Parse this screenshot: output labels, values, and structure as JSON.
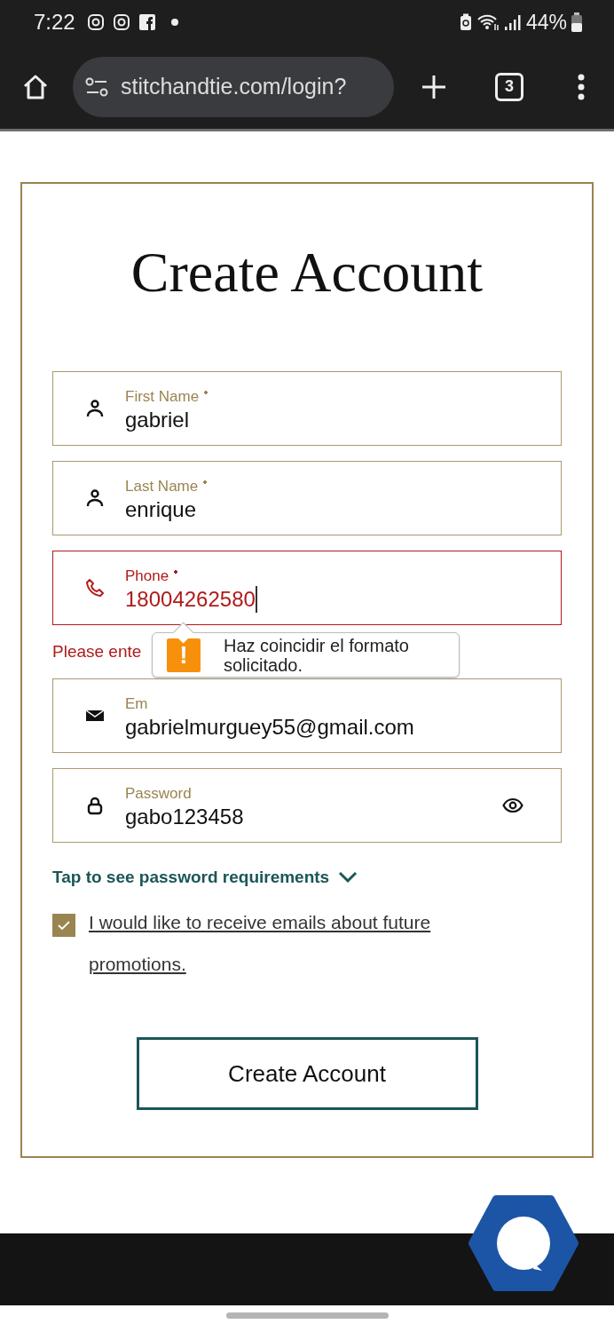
{
  "status_bar": {
    "time": "7:22",
    "battery": "44%"
  },
  "browser": {
    "url": "stitchandtie.com/login?",
    "tab_count": "3"
  },
  "form": {
    "title": "Create Account",
    "fields": [
      {
        "kind": "name",
        "label": "First Name",
        "required": true,
        "value": "gabriel",
        "invalid": false
      },
      {
        "kind": "name",
        "label": "Last Name",
        "required": true,
        "value": "enrique",
        "invalid": false
      },
      {
        "kind": "phone",
        "label": "Phone",
        "required": true,
        "value": "18004262580",
        "invalid": true,
        "focused": true,
        "error": "Please ente"
      },
      {
        "kind": "email",
        "label": "Em",
        "required": false,
        "value": "gabrielmurguey55@gmail.com",
        "invalid": false
      },
      {
        "kind": "password",
        "label": "Password",
        "required": false,
        "value": "gabo123458",
        "invalid": false
      }
    ],
    "requirements_link": "Tap to see password requirements",
    "promo_checkbox": {
      "label": "I would like to receive emails about future promotions.",
      "checked": true
    },
    "submit": "Create Account"
  },
  "tooltip": {
    "text": "Haz coincidir el formato solicitado.",
    "icon": "!"
  }
}
